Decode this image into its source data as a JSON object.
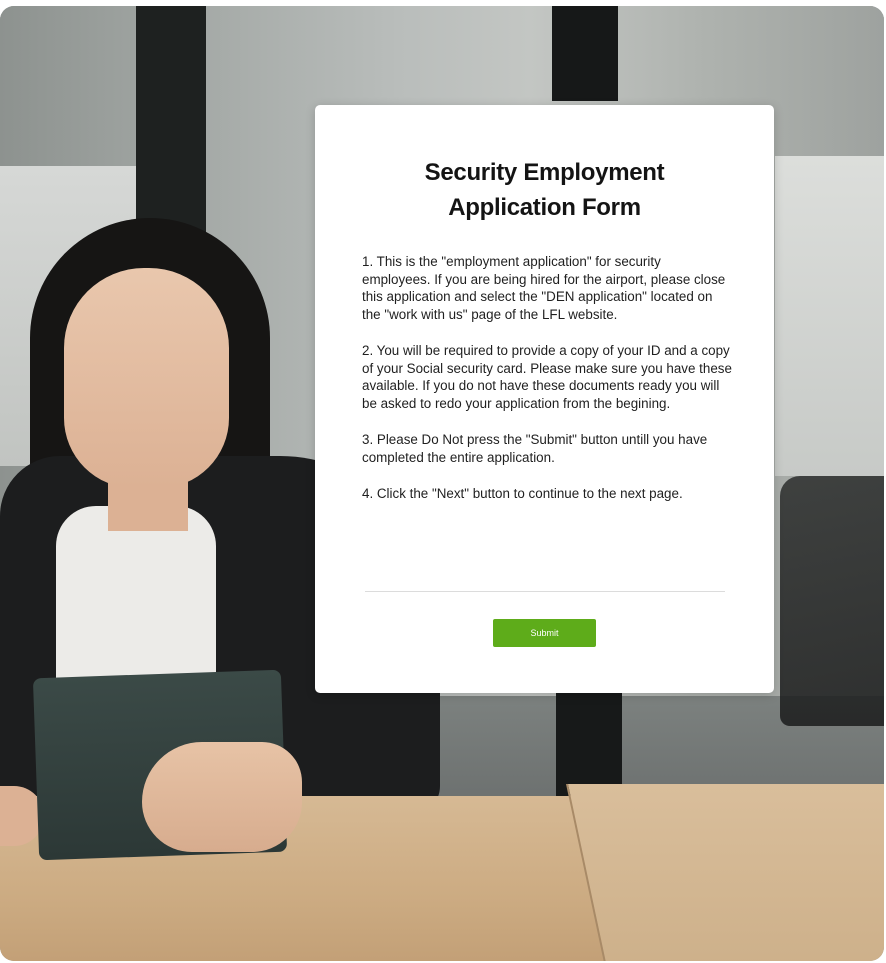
{
  "dialog": {
    "title_line1": "Security Employment",
    "title_line2": "Application Form",
    "paragraphs": [
      "1. This is the \"employment application\" for security employees. If you are being hired for the airport, please close this application and select the \"DEN application\" located on the \"work with us\" page of the LFL website.",
      "2. You will be required to provide a copy of your ID and a copy of your Social security card. Please make sure you have these available. If you do not have these documents ready you will be asked to redo your application from the begining.",
      "3. Please Do Not press the \"Submit\" button untill you have completed the entire application.",
      "4. Click the \"Next\" button to continue to the next page."
    ],
    "submit_label": "Submit"
  },
  "colors": {
    "submit_button": "#5eac1a",
    "card_background": "#ffffff",
    "title_text": "#141414"
  }
}
